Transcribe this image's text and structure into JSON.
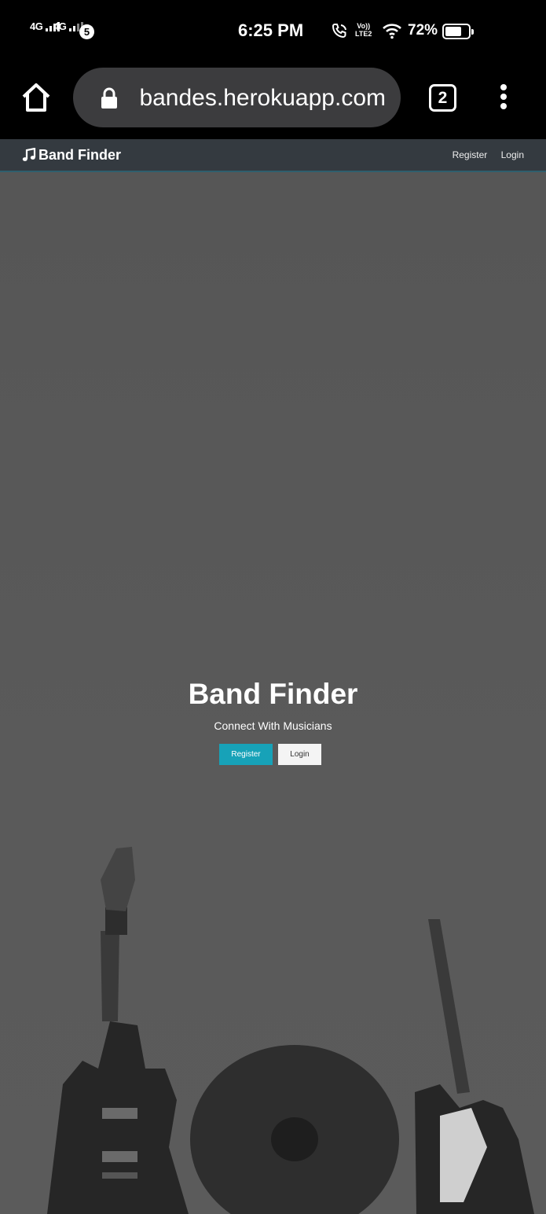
{
  "status_bar": {
    "network_1": "4G",
    "network_2": "4G",
    "notification_count": "5",
    "time": "6:25 PM",
    "volte_line1": "Vo))",
    "volte_line2": "LTE2",
    "battery_percent": "72%",
    "battery_level": 0.72
  },
  "browser": {
    "url": "bandes.herokuapp.com",
    "tab_count": "2"
  },
  "navbar": {
    "brand": "Band Finder",
    "links": [
      "Register",
      "Login"
    ]
  },
  "hero": {
    "title": "Band Finder",
    "subtitle": "Connect With Musicians",
    "register_label": "Register",
    "login_label": "Login"
  }
}
